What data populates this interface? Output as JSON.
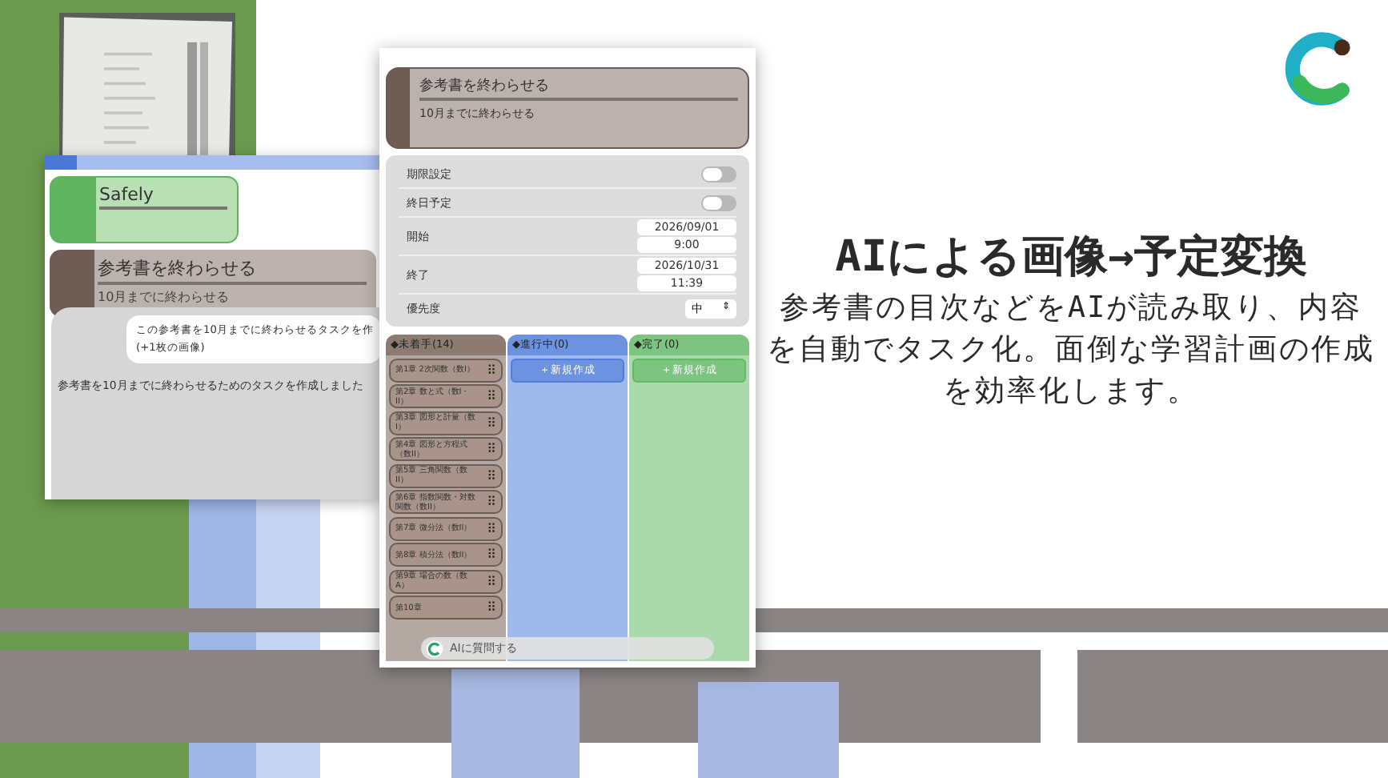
{
  "chat_screen": {
    "cards": [
      {
        "title": "Safely",
        "kind": "green"
      },
      {
        "title": "参考書を終わらせる",
        "note": "10月までに終わらせる",
        "kind": "brown"
      }
    ],
    "user_message": "この参考書を10月までに終わらせるタスクを作",
    "attachment": "(+1枚の画像)",
    "ai_reply": "参考書を10月までに終わらせるためのタスクを作成しました"
  },
  "task_screen": {
    "task": {
      "title": "参考書を終わらせる",
      "note": "10月までに終わらせる"
    },
    "settings": [
      {
        "kind": "toggle",
        "label": "期限設定",
        "on": false
      },
      {
        "kind": "toggle",
        "label": "終日予定",
        "on": false
      },
      {
        "kind": "datetime",
        "label": "開始",
        "date": "2026/09/01",
        "time": "9:00"
      },
      {
        "kind": "datetime",
        "label": "終了",
        "date": "2026/10/31",
        "time": "11:39"
      },
      {
        "kind": "select",
        "label": "優先度",
        "value": "中",
        "arrows": "⇕"
      }
    ],
    "columns": [
      {
        "title": "◆未着手(14)",
        "color": "#8b7b70",
        "cards": [
          "第1章 2次関数（数I）",
          "第2章 数と式（数I・II）",
          "第3章 図形と計量（数I）",
          "第4章 図形と方程式（数II）",
          "第5章 三角関数（数II）",
          "第6章 指数関数・対数関数（数II）",
          "第7章 微分法（数II）",
          "第8章 積分法（数II）",
          "第9章 場合の数（数A）",
          "第10章"
        ]
      },
      {
        "title": "◆進行中(0)",
        "color": "#6d93e0",
        "new_button": "＋新規作成"
      },
      {
        "title": "◆完了(0)",
        "color": "#7cc47f",
        "new_button": "＋新規作成"
      }
    ],
    "ask_ai": "AIに質問する",
    "grip": "⠿"
  },
  "headline": "AIによる画像→予定変換",
  "description": "参考書の目次などをAIが読み取り、内容を自動でタスク化。面倒な学習計画の作成を効率化します。"
}
